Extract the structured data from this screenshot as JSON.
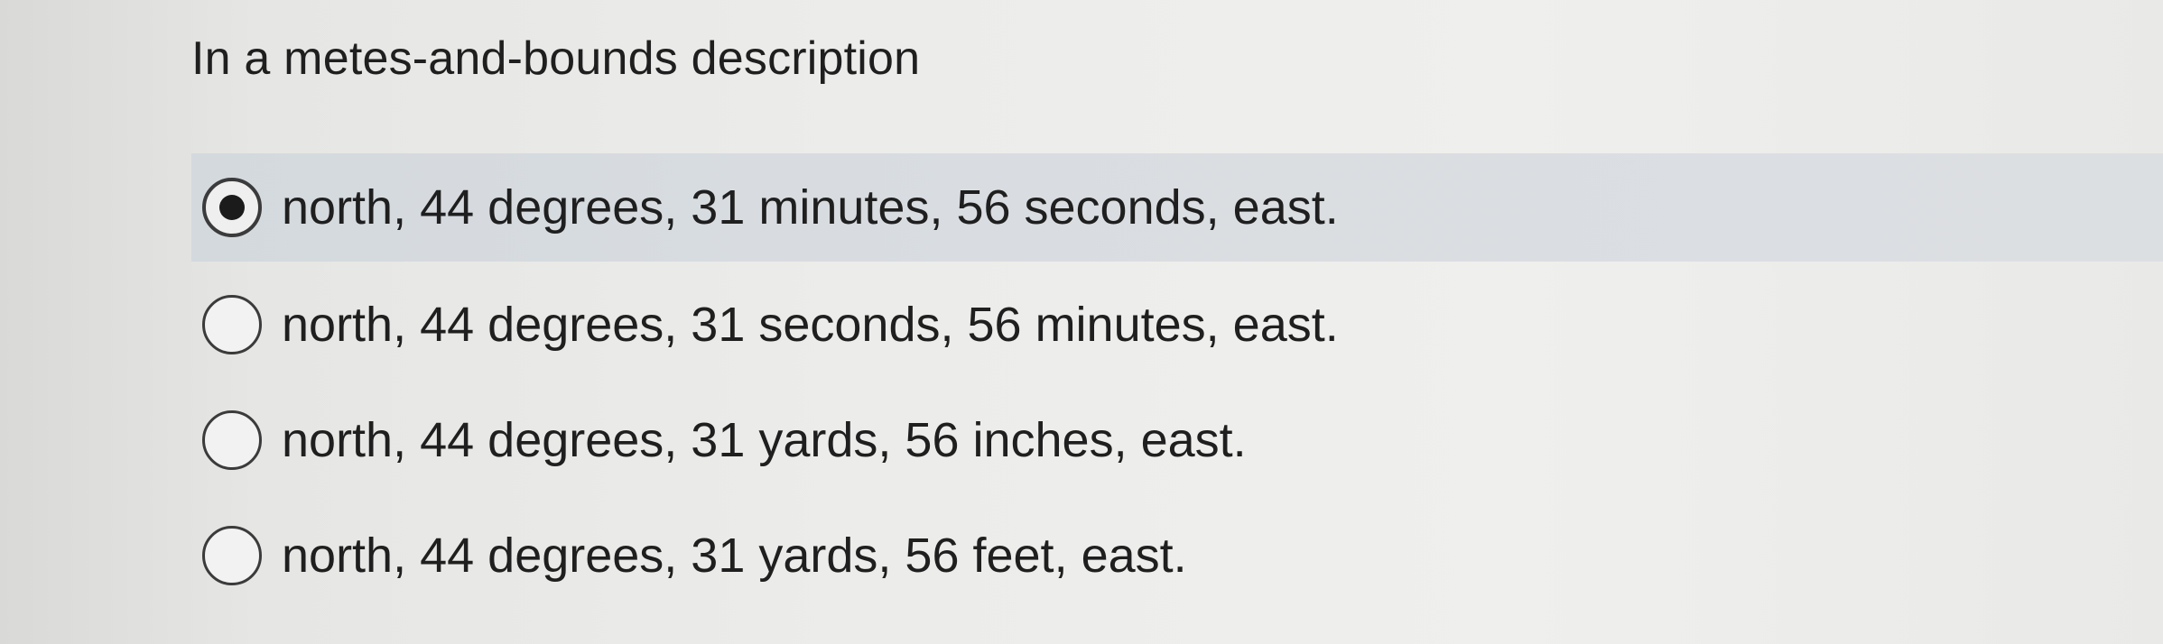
{
  "question": {
    "text": "In a metes-and-bounds description"
  },
  "options": [
    {
      "label": "north, 44 degrees, 31 minutes, 56 seconds, east.",
      "selected": true
    },
    {
      "label": "north, 44 degrees, 31 seconds, 56 minutes, east.",
      "selected": false
    },
    {
      "label": "north, 44 degrees, 31 yards, 56 inches, east.",
      "selected": false
    },
    {
      "label": "north, 44 degrees, 31 yards, 56 feet, east.",
      "selected": false
    }
  ],
  "colors": {
    "selected_row_highlight": "#d9dde1",
    "radio_border": "#3b3b3b",
    "text": "#1f1f1f"
  }
}
